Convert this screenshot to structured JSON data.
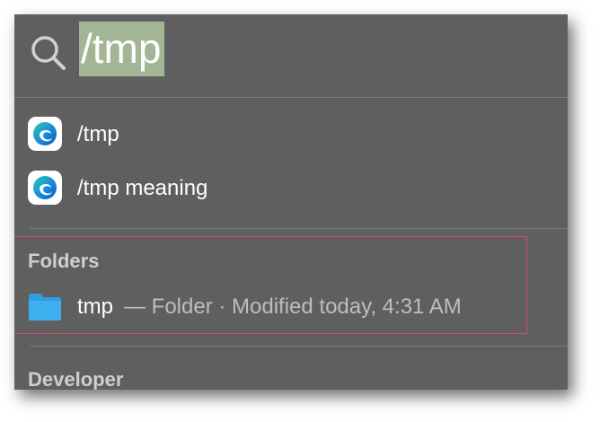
{
  "search": {
    "value": "/tmp"
  },
  "web_results": [
    {
      "label": "/tmp",
      "icon": "edge-icon"
    },
    {
      "label": "/tmp meaning",
      "icon": "edge-icon"
    }
  ],
  "sections": {
    "folders": {
      "header": "Folders",
      "items": [
        {
          "name": "tmp",
          "meta": "— Folder · Modified today, 4:31 AM",
          "icon": "folder-icon"
        }
      ]
    },
    "developer": {
      "header": "Developer"
    }
  },
  "colors": {
    "panel_background": "#5f5f5f",
    "search_selection": "#a2b595",
    "annotation_box": "#d64a73",
    "folder_blue": "#3eb0f0"
  }
}
